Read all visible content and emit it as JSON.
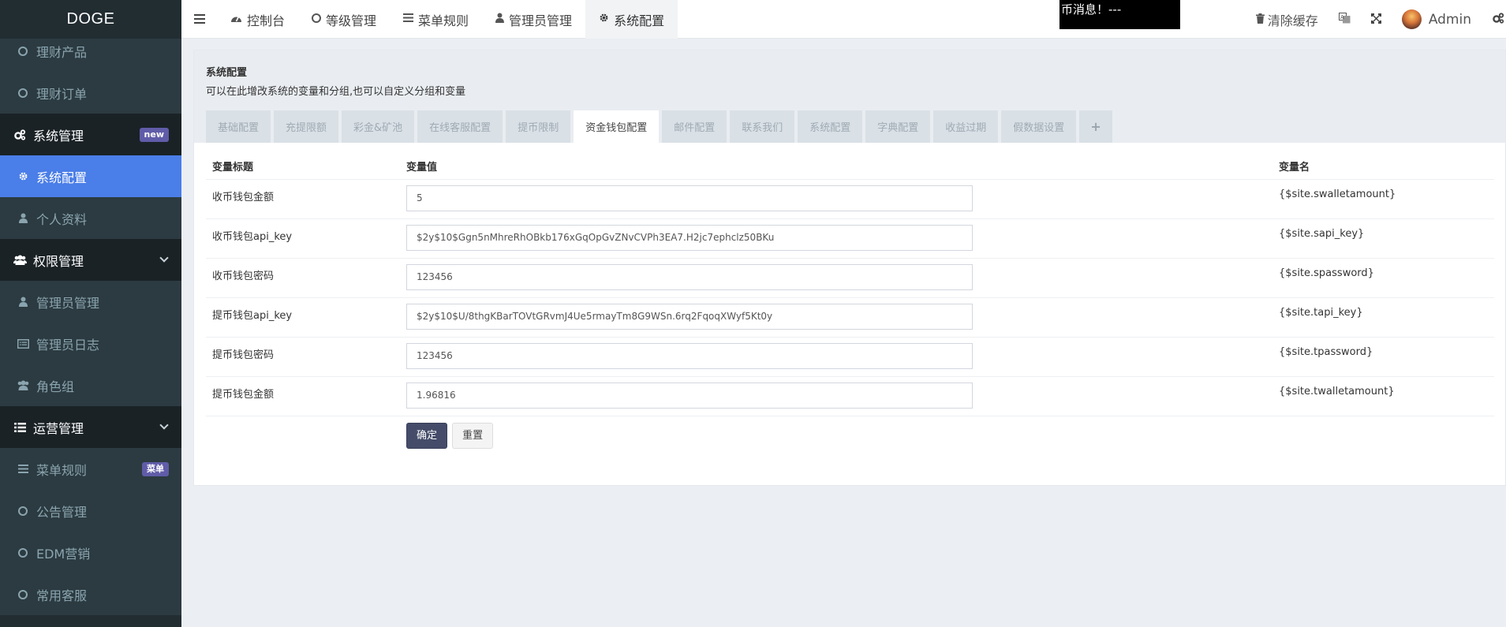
{
  "app": {
    "logo": "DOGE"
  },
  "sidebar": {
    "items": [
      {
        "label": "理财产品",
        "icon": "circle-icon",
        "type": "sub"
      },
      {
        "label": "理财订单",
        "icon": "circle-icon",
        "type": "sub"
      },
      {
        "label": "系统管理",
        "icon": "cogs-icon",
        "type": "hdr",
        "badge": "new"
      },
      {
        "label": "系统配置",
        "icon": "gear-icon",
        "type": "active"
      },
      {
        "label": "个人资料",
        "icon": "user-icon",
        "type": "sub"
      },
      {
        "label": "权限管理",
        "icon": "users-icon",
        "type": "hdr"
      },
      {
        "label": "管理员管理",
        "icon": "user-icon",
        "type": "sub"
      },
      {
        "label": "管理员日志",
        "icon": "list-alt-icon",
        "type": "sub"
      },
      {
        "label": "角色组",
        "icon": "users-icon",
        "type": "sub"
      },
      {
        "label": "运营管理",
        "icon": "list-icon",
        "type": "hdr"
      },
      {
        "label": "菜单规则",
        "icon": "bars-icon",
        "type": "sub",
        "badge": "菜单"
      },
      {
        "label": "公告管理",
        "icon": "circle-icon",
        "type": "sub"
      },
      {
        "label": "EDM营销",
        "icon": "circle-icon",
        "type": "sub"
      },
      {
        "label": "常用客服",
        "icon": "circle-icon",
        "type": "sub"
      }
    ]
  },
  "topbar": {
    "nav": [
      {
        "label": "控制台",
        "icon": "dashboard-icon"
      },
      {
        "label": "等级管理",
        "icon": "circle-icon"
      },
      {
        "label": "菜单规则",
        "icon": "bars-icon"
      },
      {
        "label": "管理员管理",
        "icon": "user-icon"
      },
      {
        "label": "系统配置",
        "icon": "gear-icon",
        "active": true
      }
    ],
    "marquee": "币消息！---",
    "clear_cache": "清除缓存",
    "user": "Admin"
  },
  "panel": {
    "title": "系统配置",
    "desc": "可以在此增改系统的变量和分组,也可以自定义分组和变量",
    "tabs": [
      "基础配置",
      "充提限额",
      "彩金&矿池",
      "在线客服配置",
      "提币限制",
      "资金钱包配置",
      "邮件配置",
      "联系我们",
      "系统配置",
      "字典配置",
      "收益过期",
      "假数据设置"
    ],
    "active_tab": 5,
    "plus": "+",
    "cols": {
      "title": "变量标题",
      "value": "变量值",
      "name": "变量名"
    },
    "rows": [
      {
        "title": "收币钱包金额",
        "value": "5",
        "name": "{$site.swalletamount}"
      },
      {
        "title": "收币钱包api_key",
        "value": "$2y$10$Ggn5nMhreRhOBkb176xGqOpGvZNvCVPh3EA7.H2jc7ephclz50BKu",
        "name": "{$site.sapi_key}"
      },
      {
        "title": "收币钱包密码",
        "value": "123456",
        "name": "{$site.spassword}"
      },
      {
        "title": "提币钱包api_key",
        "value": "$2y$10$U/8thgKBarTOVtGRvmJ4Ue5rmayTm8G9WSn.6rq2FqoqXWyf5Kt0y",
        "name": "{$site.tapi_key}"
      },
      {
        "title": "提币钱包密码",
        "value": "123456",
        "name": "{$site.tpassword}"
      },
      {
        "title": "提币钱包金额",
        "value": "1.96816",
        "name": "{$site.twalletamount}"
      }
    ],
    "btn_ok": "确定",
    "btn_reset": "重置"
  }
}
